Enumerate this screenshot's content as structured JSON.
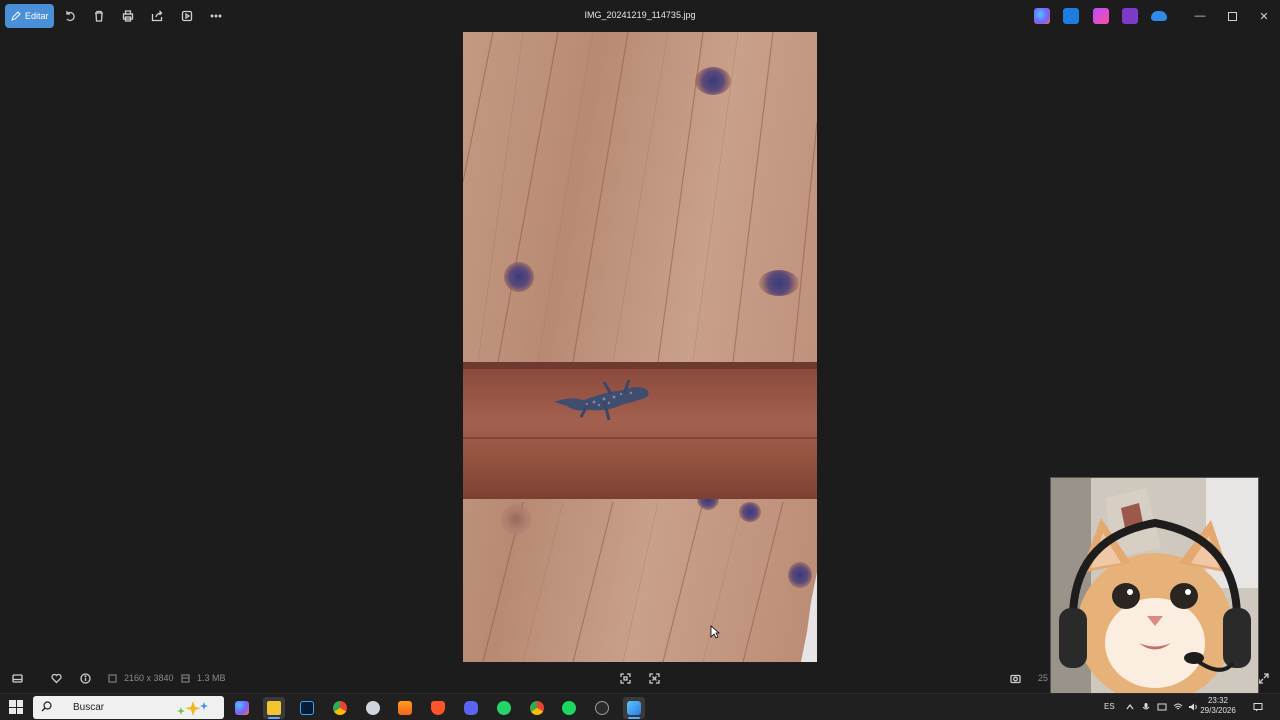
{
  "window": {
    "filename": "IMG_20241219_114735.jpg",
    "edit_label": "Editar"
  },
  "toolbar": {
    "icons": [
      "rotate-icon",
      "delete-icon",
      "print-icon",
      "share-icon",
      "slideshow-icon",
      "more-icon"
    ]
  },
  "status": {
    "dimensions": "2160 x 3840",
    "file_size": "1.3 MB",
    "zoom_partial": "25"
  },
  "taskbar": {
    "search_placeholder": "Buscar",
    "language": "ES",
    "time": "23:32",
    "date": "29/3/2026",
    "apps": [
      "copilot",
      "file-explorer",
      "photoshop",
      "chrome",
      "app-5",
      "fl-studio",
      "brave",
      "discord",
      "whatsapp",
      "chrome-profile",
      "spotify",
      "app-12",
      "photos"
    ]
  },
  "colors": {
    "accent": "#4a90d9",
    "background": "#1c1c1c",
    "taskbar": "#202020"
  }
}
